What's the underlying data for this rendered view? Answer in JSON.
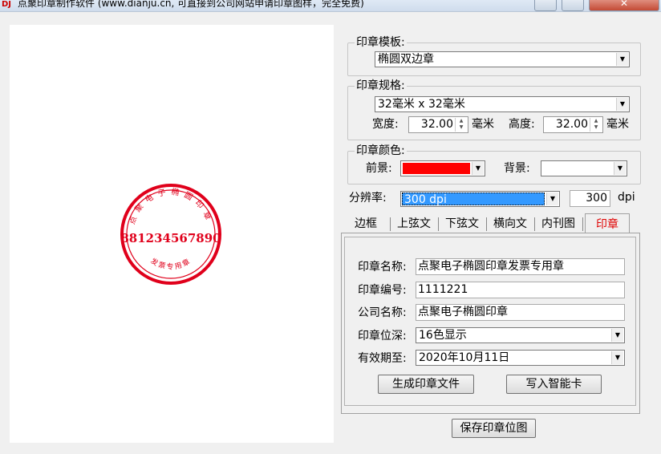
{
  "window": {
    "title": "点聚印章制作软件 (www.dianju.cn, 可直接到公司网站申请印章图样，完全免费)"
  },
  "stamp": {
    "outer_text": "点聚电子椭圆印章",
    "number": "881234567890",
    "bottom_text": "发票专用章",
    "color": "#e0001b"
  },
  "template_group": {
    "legend": "印章模板:",
    "selected": "椭圆双边章"
  },
  "spec_group": {
    "legend": "印章规格:",
    "selected": "32毫米 x 32毫米",
    "width_label": "宽度:",
    "width_value": "32.00",
    "width_unit": "毫米",
    "height_label": "高度:",
    "height_value": "32.00",
    "height_unit": "毫米"
  },
  "color_group": {
    "legend": "印章颜色:",
    "fg_label": "前景:",
    "fg_color": "#ff0000",
    "bg_label": "背景:",
    "bg_color": "#ffffff"
  },
  "resolution": {
    "label": "分辨率:",
    "selected": "300 dpi",
    "value": "300",
    "unit": "dpi"
  },
  "tabs": [
    {
      "label": "边框"
    },
    {
      "label": "上弦文"
    },
    {
      "label": "下弦文"
    },
    {
      "label": "横向文"
    },
    {
      "label": "内刊图"
    },
    {
      "label": "印章",
      "active": true,
      "color": "#e00000"
    }
  ],
  "form": {
    "name_label": "印章名称:",
    "name_value": "点聚电子椭圆印章发票专用章",
    "code_label": "印章编号:",
    "code_value": "1111221",
    "company_label": "公司名称:",
    "company_value": "点聚电子椭圆印章",
    "depth_label": "印章位深:",
    "depth_value": "16色显示",
    "expiry_label": "有效期至:",
    "expiry_value": "2020年10月11日"
  },
  "buttons": {
    "generate": "生成印章文件",
    "write_card": "写入智能卡",
    "save": "保存印章位图"
  }
}
